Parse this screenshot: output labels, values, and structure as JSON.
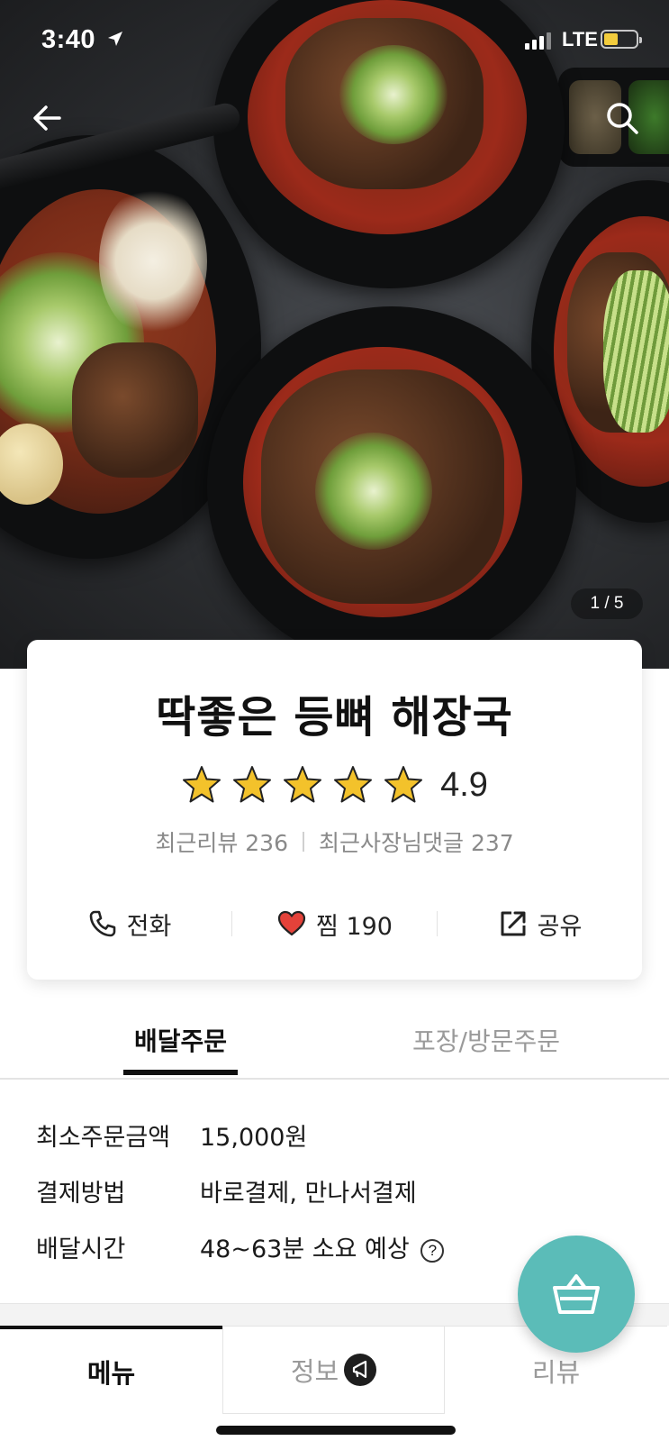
{
  "status_bar": {
    "time": "3:40",
    "network": "LTE",
    "battery_level": 0.45
  },
  "hero": {
    "pager": "1 / 5",
    "icons": [
      "back-arrow-icon",
      "search-icon"
    ]
  },
  "store": {
    "name": "딱좋은 등뼈 해장국",
    "rating": "4.9",
    "stars": 5,
    "recent_reviews": "최근리뷰 236",
    "owner_replies": "최근사장님댓글 237",
    "actions": {
      "call": "전화",
      "like": "찜 190",
      "share": "공유"
    }
  },
  "order_tabs": {
    "delivery": "배달주문",
    "pickup": "포장/방문주문"
  },
  "info": {
    "min_order_label": "최소주문금액",
    "min_order_value": "15,000원",
    "payment_label": "결제방법",
    "payment_value": "바로결제, 만나서결제",
    "delivery_time_label": "배달시간",
    "delivery_time_value": "48~63분 소요 예상",
    "help_glyph": "?"
  },
  "bottom_tabs": {
    "menu": "메뉴",
    "info": "정보",
    "review": "리뷰"
  },
  "colors": {
    "accent": "#5bbcb8",
    "star": "#f3c22b",
    "heart": "#e4423a"
  }
}
